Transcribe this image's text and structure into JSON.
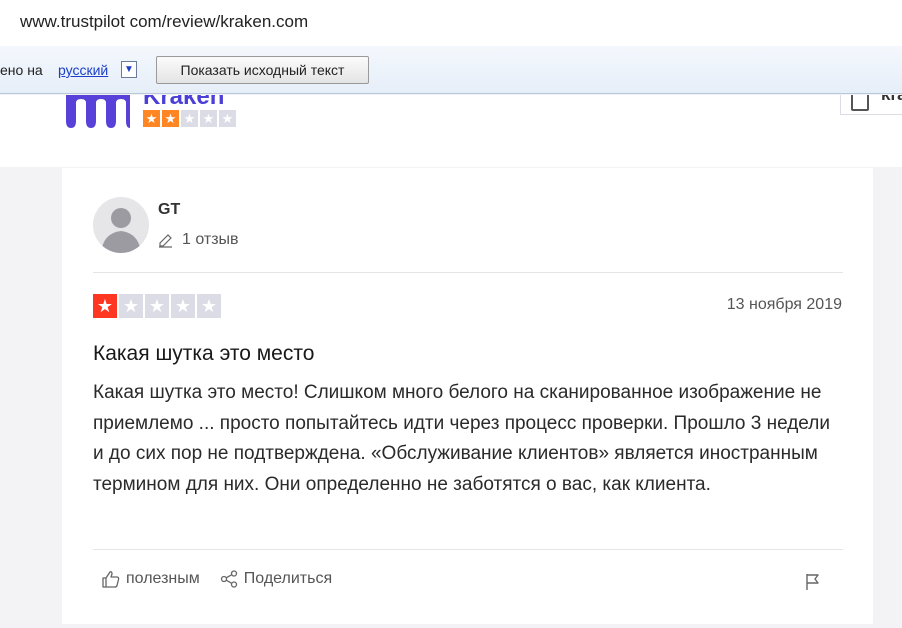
{
  "browser": {
    "url": "www.trustpilot com/review/kraken.com"
  },
  "translate_bar": {
    "prefix": "ено на",
    "language": "русский",
    "dropdown_glyph": "▼",
    "show_original_label": "Показать исходный текст"
  },
  "company": {
    "name": "Kraken",
    "rating_stars": 2,
    "max_stars": 5,
    "write_label": "kra"
  },
  "review": {
    "user_name": "GT",
    "review_count": "1 отзыв",
    "rating_stars": 1,
    "max_stars": 5,
    "date": "13 ноября 2019",
    "title": "Какая шутка это место",
    "body": "Какая шутка это место! Слишком много белого на сканированное изображение не приемлемо ... просто попытайтесь идти через процесс проверки. Прошло 3 недели и до сих пор не подтверждена. «Обслуживание клиентов» является иностранным термином для них. Они определенно не заботятся о вас, как клиента.",
    "useful_label": "полезным",
    "share_label": "Поделиться"
  },
  "colors": {
    "review_star": "#ff3722",
    "company_star": "#ff8622",
    "empty_star": "#dcdce6",
    "brand": "#5741d9"
  },
  "icons": [
    "pencil-icon",
    "thumbs-up-icon",
    "share-icon",
    "flag-icon",
    "user-avatar-icon",
    "star-icon",
    "kraken-logo"
  ]
}
